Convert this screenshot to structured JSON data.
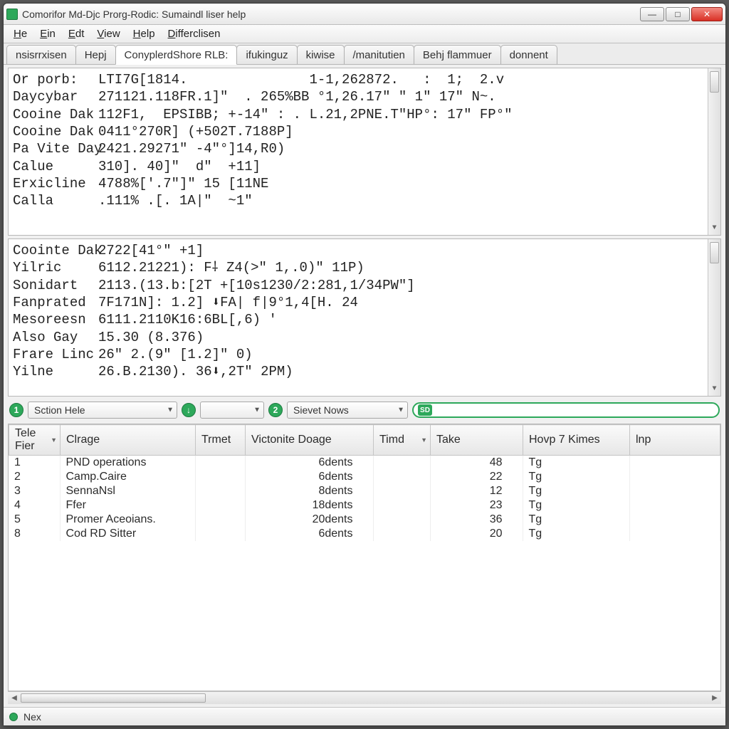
{
  "window": {
    "title": "Comorifor Md-Djc Prorg-Rodic: Sumaindl liser help"
  },
  "window_buttons": {
    "min": "—",
    "max": "□",
    "close": "✕"
  },
  "menu": [
    "He",
    "Ein",
    "Edt",
    "View",
    "Help",
    "Differclisen"
  ],
  "tabs": {
    "items": [
      "nsisrrxisen",
      "Hepj",
      "ConyplerdShore RLB:",
      "ifukinguz",
      "kiwise",
      "/manitutien",
      "Behj flammuer",
      "donnent"
    ],
    "active_index": 2
  },
  "pane1": [
    {
      "label": "Or porb:",
      "value": "LTI7G[1814.               1-1,262872.   :  1;  2.v"
    },
    {
      "label": "Daycybar",
      "value": "271121.118FR.1]\"  . 265%BB °1,26.17\" \" 1\" 17\" N~."
    },
    {
      "label": "Cooine Dak",
      "value": "112F1,  EPSIBB; +-14\" : . L.21,2PNE.T\"HP°: 17\" FP°\""
    },
    {
      "label": "Cooine Dak",
      "value": "0411°270R] (+502T.7188P]"
    },
    {
      "label": "Pa Vite Day",
      "value": "2421.29271\" -4\"°]14,R0)"
    },
    {
      "label": "Calue",
      "value": "310]. 40]\"  d\"  +11]"
    },
    {
      "label": "Erxicline",
      "value": "4788%['.7\"]\" 15 [11NE"
    },
    {
      "label": "Calla",
      "value": ".111% .[. 1A|\"  ~1\""
    }
  ],
  "pane2": [
    {
      "label": "Coointe Dak",
      "value": "2722[41°\" +1]"
    },
    {
      "label": "Yilric",
      "value": "6112.21221): F⸸ Z4(>\" 1,.0)\" 11P)"
    },
    {
      "label": "Sonidart",
      "value": "2113.(13.b:[2T +[10s1230/2:281,1/34PW\"]"
    },
    {
      "label": "Fanprated",
      "value": "7F171N]: 1.2] ⬇FA| f|9°1,4[H. 24"
    },
    {
      "label": "Mesoreesn",
      "value": "6111.2110K16:6BL[,6) '"
    },
    {
      "label": "Also Gay",
      "value": "15.30 (8.376)"
    },
    {
      "label": "Frare Linc",
      "value": "26\" 2.(9\" [1.2]\" 0)"
    },
    {
      "label": "Yilne",
      "value": "26.B.2130). 36⬇,2T\" 2PM)"
    }
  ],
  "controlbar": {
    "badge1": "1",
    "section_label": "Sction Hele",
    "badge2": "↓",
    "small_combo": "",
    "badge3": "2",
    "sievet_label": "Sievet Nows",
    "sd_label": "SD"
  },
  "grid": {
    "headers": [
      "Tele Fier",
      "Clrage",
      "Trmet",
      "Victonite Doage",
      "Timd",
      "Take",
      "Hovp 7 Kimes",
      "lnp"
    ],
    "rows": [
      {
        "id": "1",
        "clrage": "PND operations",
        "trmet": "",
        "vict": "6dents",
        "timd": "",
        "take": "48",
        "hovp": "Tg",
        "lnp": ""
      },
      {
        "id": "2",
        "clrage": "Camp.Caire",
        "trmet": "",
        "vict": "6dents",
        "timd": "",
        "take": "22",
        "hovp": "Tg",
        "lnp": ""
      },
      {
        "id": "3",
        "clrage": "SennaNsl",
        "trmet": "",
        "vict": "8dents",
        "timd": "",
        "take": "12",
        "hovp": "Tg",
        "lnp": ""
      },
      {
        "id": "4",
        "clrage": "Ffer",
        "trmet": "",
        "vict": "18dents",
        "timd": "",
        "take": "23",
        "hovp": "Tg",
        "lnp": ""
      },
      {
        "id": "5",
        "clrage": "Promer Aceoians.",
        "trmet": "",
        "vict": "20dents",
        "timd": "",
        "take": "36",
        "hovp": "Tg",
        "lnp": ""
      },
      {
        "id": "8",
        "clrage": "Cod RD Sitter",
        "trmet": "",
        "vict": "6dents",
        "timd": "",
        "take": "20",
        "hovp": "Tg",
        "lnp": ""
      }
    ]
  },
  "statusbar": {
    "text": "Nex"
  }
}
